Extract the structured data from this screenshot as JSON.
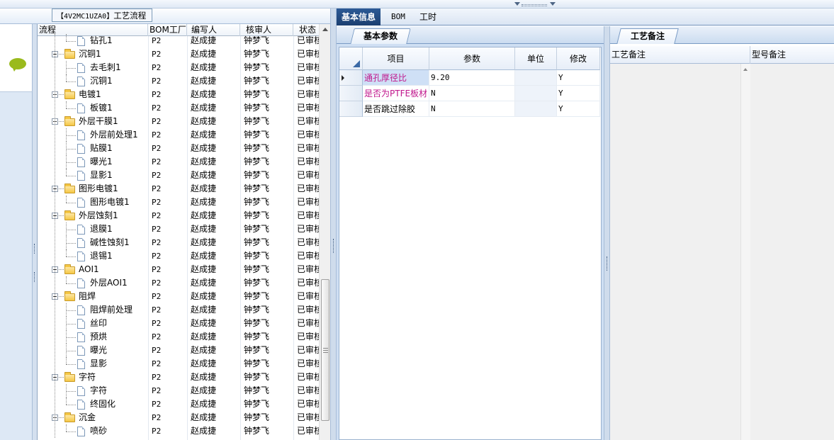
{
  "window": {
    "title_code": "【4V2MC1UZA0】",
    "title_label": "工艺流程"
  },
  "tree": {
    "columns": [
      "流程",
      "BOM工厂",
      "编写人",
      "核审人",
      "状态"
    ],
    "rows": [
      {
        "level": 1,
        "type": "doc",
        "name": "钻孔1",
        "factory": "P2",
        "author": "赵成捷",
        "reviewer": "钟梦飞",
        "status": "已审核"
      },
      {
        "level": 0,
        "type": "folder",
        "name": "沉铜1",
        "factory": "P2",
        "author": "赵成捷",
        "reviewer": "钟梦飞",
        "status": "已审核"
      },
      {
        "level": 1,
        "type": "doc",
        "name": "去毛刺1",
        "factory": "P2",
        "author": "赵成捷",
        "reviewer": "钟梦飞",
        "status": "已审核"
      },
      {
        "level": 1,
        "type": "doc",
        "name": "沉铜1",
        "factory": "P2",
        "author": "赵成捷",
        "reviewer": "钟梦飞",
        "status": "已审核"
      },
      {
        "level": 0,
        "type": "folder",
        "name": "电镀1",
        "factory": "P2",
        "author": "赵成捷",
        "reviewer": "钟梦飞",
        "status": "已审核"
      },
      {
        "level": 1,
        "type": "doc",
        "name": "板镀1",
        "factory": "P2",
        "author": "赵成捷",
        "reviewer": "钟梦飞",
        "status": "已审核"
      },
      {
        "level": 0,
        "type": "folder",
        "name": "外层干膜1",
        "factory": "P2",
        "author": "赵成捷",
        "reviewer": "钟梦飞",
        "status": "已审核"
      },
      {
        "level": 1,
        "type": "doc",
        "name": "外层前处理1",
        "factory": "P2",
        "author": "赵成捷",
        "reviewer": "钟梦飞",
        "status": "已审核"
      },
      {
        "level": 1,
        "type": "doc",
        "name": "贴膜1",
        "factory": "P2",
        "author": "赵成捷",
        "reviewer": "钟梦飞",
        "status": "已审核"
      },
      {
        "level": 1,
        "type": "doc",
        "name": "曝光1",
        "factory": "P2",
        "author": "赵成捷",
        "reviewer": "钟梦飞",
        "status": "已审核"
      },
      {
        "level": 1,
        "type": "doc",
        "name": "显影1",
        "factory": "P2",
        "author": "赵成捷",
        "reviewer": "钟梦飞",
        "status": "已审核"
      },
      {
        "level": 0,
        "type": "folder",
        "name": "图形电镀1",
        "factory": "P2",
        "author": "赵成捷",
        "reviewer": "钟梦飞",
        "status": "已审核"
      },
      {
        "level": 1,
        "type": "doc",
        "name": "图形电镀1",
        "factory": "P2",
        "author": "赵成捷",
        "reviewer": "钟梦飞",
        "status": "已审核"
      },
      {
        "level": 0,
        "type": "folder",
        "name": "外层蚀刻1",
        "factory": "P2",
        "author": "赵成捷",
        "reviewer": "钟梦飞",
        "status": "已审核"
      },
      {
        "level": 1,
        "type": "doc",
        "name": "退膜1",
        "factory": "P2",
        "author": "赵成捷",
        "reviewer": "钟梦飞",
        "status": "已审核"
      },
      {
        "level": 1,
        "type": "doc",
        "name": "碱性蚀刻1",
        "factory": "P2",
        "author": "赵成捷",
        "reviewer": "钟梦飞",
        "status": "已审核"
      },
      {
        "level": 1,
        "type": "doc",
        "name": "退锡1",
        "factory": "P2",
        "author": "赵成捷",
        "reviewer": "钟梦飞",
        "status": "已审核"
      },
      {
        "level": 0,
        "type": "folder",
        "name": "AOI1",
        "factory": "P2",
        "author": "赵成捷",
        "reviewer": "钟梦飞",
        "status": "已审核"
      },
      {
        "level": 1,
        "type": "doc",
        "name": "外层AOI1",
        "factory": "P2",
        "author": "赵成捷",
        "reviewer": "钟梦飞",
        "status": "已审核"
      },
      {
        "level": 0,
        "type": "folder",
        "name": "阻焊",
        "factory": "P2",
        "author": "赵成捷",
        "reviewer": "钟梦飞",
        "status": "已审核"
      },
      {
        "level": 1,
        "type": "doc",
        "name": "阻焊前处理",
        "factory": "P2",
        "author": "赵成捷",
        "reviewer": "钟梦飞",
        "status": "已审核"
      },
      {
        "level": 1,
        "type": "doc",
        "name": "丝印",
        "factory": "P2",
        "author": "赵成捷",
        "reviewer": "钟梦飞",
        "status": "已审核"
      },
      {
        "level": 1,
        "type": "doc",
        "name": "预烘",
        "factory": "P2",
        "author": "赵成捷",
        "reviewer": "钟梦飞",
        "status": "已审核"
      },
      {
        "level": 1,
        "type": "doc",
        "name": "曝光",
        "factory": "P2",
        "author": "赵成捷",
        "reviewer": "钟梦飞",
        "status": "已审核"
      },
      {
        "level": 1,
        "type": "doc",
        "name": "显影",
        "factory": "P2",
        "author": "赵成捷",
        "reviewer": "钟梦飞",
        "status": "已审核"
      },
      {
        "level": 0,
        "type": "folder",
        "name": "字符",
        "factory": "P2",
        "author": "赵成捷",
        "reviewer": "钟梦飞",
        "status": "已审核"
      },
      {
        "level": 1,
        "type": "doc",
        "name": "字符",
        "factory": "P2",
        "author": "赵成捷",
        "reviewer": "钟梦飞",
        "status": "已审核"
      },
      {
        "level": 1,
        "type": "doc",
        "name": "终固化",
        "factory": "P2",
        "author": "赵成捷",
        "reviewer": "钟梦飞",
        "status": "已审核"
      },
      {
        "level": 0,
        "type": "folder",
        "name": "沉金",
        "factory": "P2",
        "author": "赵成捷",
        "reviewer": "钟梦飞",
        "status": "已审核"
      },
      {
        "level": 1,
        "type": "doc",
        "name": "喷砂",
        "factory": "P2",
        "author": "赵成捷",
        "reviewer": "钟梦飞",
        "status": "已审核"
      }
    ]
  },
  "main_tabs": [
    "基本信息",
    "BOM",
    "工时"
  ],
  "basic_params": {
    "tab_label": "基本参数",
    "columns": [
      "项目",
      "参数",
      "单位",
      "修改"
    ],
    "rows": [
      {
        "item": "通孔厚径比",
        "value": "9.20",
        "unit": "",
        "modify": "Y",
        "highlight": true
      },
      {
        "item": "是否为PTFE板材",
        "value": "N",
        "unit": "",
        "modify": "Y",
        "highlight": true
      },
      {
        "item": "是否跳过除胶",
        "value": "N",
        "unit": "",
        "modify": "Y",
        "highlight": false
      }
    ]
  },
  "remarks": {
    "tab_label": "工艺备注",
    "columns": [
      "工艺备注",
      "型号备注"
    ]
  },
  "colors": {
    "accent_tab": "#1f4a82",
    "highlight_text": "#c0168c",
    "selected_cell": "#cfe0f6"
  }
}
